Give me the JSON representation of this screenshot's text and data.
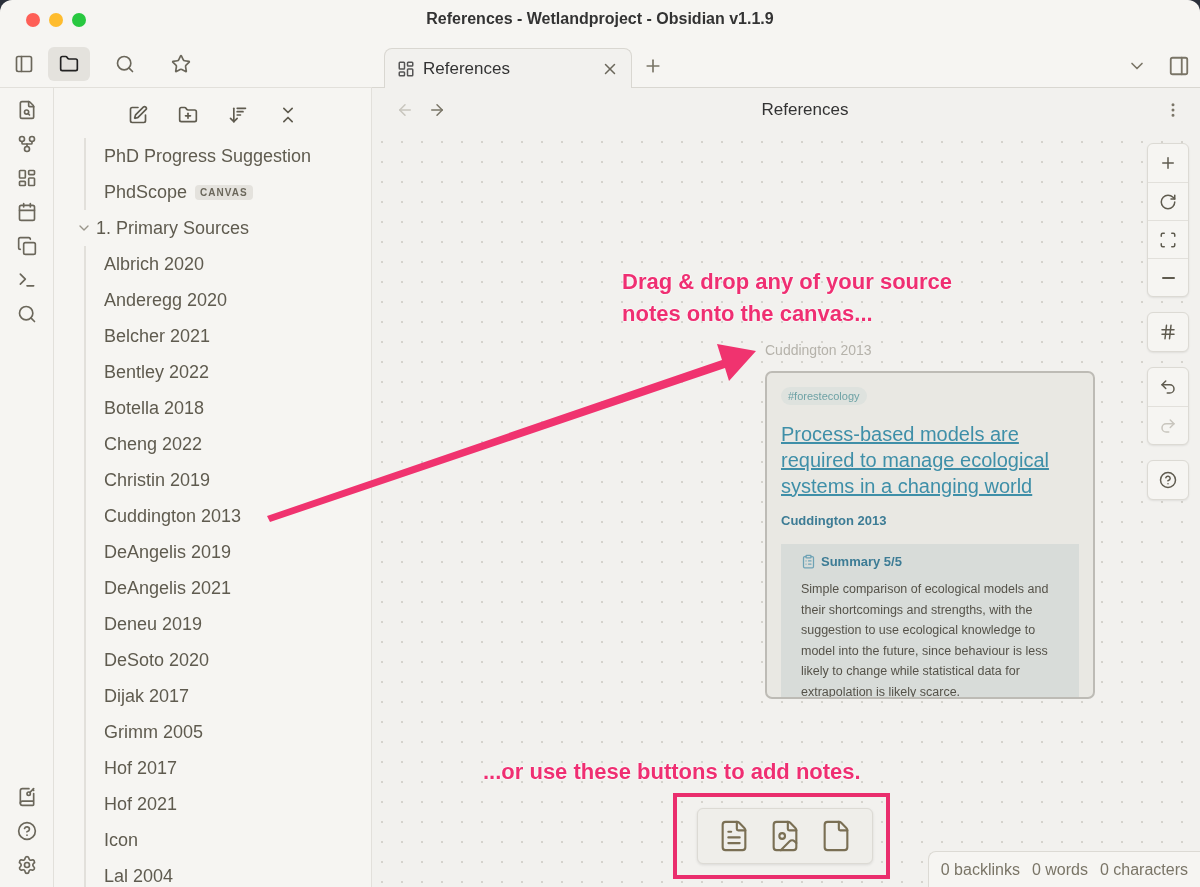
{
  "window": {
    "title": "References - Wetlandproject - Obsidian v1.1.9"
  },
  "left_panel_tabs": [
    {
      "kind": "files",
      "selected": true
    },
    {
      "kind": "search",
      "selected": false
    },
    {
      "kind": "bookmarks",
      "selected": false
    }
  ],
  "tabs": [
    {
      "label": "References",
      "selected": true
    }
  ],
  "view_header": {
    "title": "References",
    "back_disabled": true,
    "forward_disabled": false
  },
  "file_tree": [
    {
      "label": "PhD Progress Suggestion"
    },
    {
      "label": "PhdScope",
      "badge": "CANVAS"
    },
    {
      "label": "1. Primary Sources",
      "expanded": true,
      "children": [
        {
          "label": "Albrich 2020"
        },
        {
          "label": "Anderegg 2020"
        },
        {
          "label": "Belcher 2021"
        },
        {
          "label": "Bentley 2022"
        },
        {
          "label": "Botella 2018"
        },
        {
          "label": "Cheng 2022"
        },
        {
          "label": "Christin 2019"
        },
        {
          "label": "Cuddington 2013"
        },
        {
          "label": "DeAngelis 2019"
        },
        {
          "label": "DeAngelis 2021"
        },
        {
          "label": "Deneu 2019"
        },
        {
          "label": "DeSoto 2020"
        },
        {
          "label": "Dijak 2017"
        },
        {
          "label": "Grimm 2005"
        },
        {
          "label": "Hof 2017"
        },
        {
          "label": "Hof 2021"
        },
        {
          "label": "Icon"
        },
        {
          "label": "Lal 2004"
        }
      ]
    }
  ],
  "canvas": {
    "node": {
      "label": "Cuddington 2013",
      "tag": "#forestecology",
      "title": "Process-based models are required to manage ecological systems in a changing world",
      "author": "Cuddington 2013",
      "callout": {
        "title": "Summary 5/5",
        "text": "Simple comparison of ecological models and their shortcomings and strengths, with the suggestion to use ecological knowledge to model into the future, since behaviour is less likely to change while statistical data for extrapolation is likely scarce."
      }
    },
    "controls": [
      [
        {
          "kind": "zoom-in",
          "disabled": false
        },
        {
          "kind": "reset",
          "disabled": false
        },
        {
          "kind": "fit",
          "disabled": false
        },
        {
          "kind": "zoom-out",
          "disabled": false
        }
      ],
      [
        {
          "kind": "grid",
          "disabled": false
        }
      ],
      [
        {
          "kind": "undo",
          "disabled": false
        },
        {
          "kind": "redo",
          "disabled": true
        }
      ],
      [
        {
          "kind": "help",
          "disabled": false
        }
      ]
    ],
    "add_buttons": [
      {
        "kind": "note"
      },
      {
        "kind": "media"
      },
      {
        "kind": "card"
      }
    ]
  },
  "annotations": [
    {
      "kind": "drag",
      "text": "Drag & drop any of your source notes onto the canvas..."
    },
    {
      "kind": "buttons",
      "text": "...or use these buttons to add notes."
    }
  ],
  "status_bar": [
    "0 backlinks",
    "0 words",
    "0 characters"
  ]
}
